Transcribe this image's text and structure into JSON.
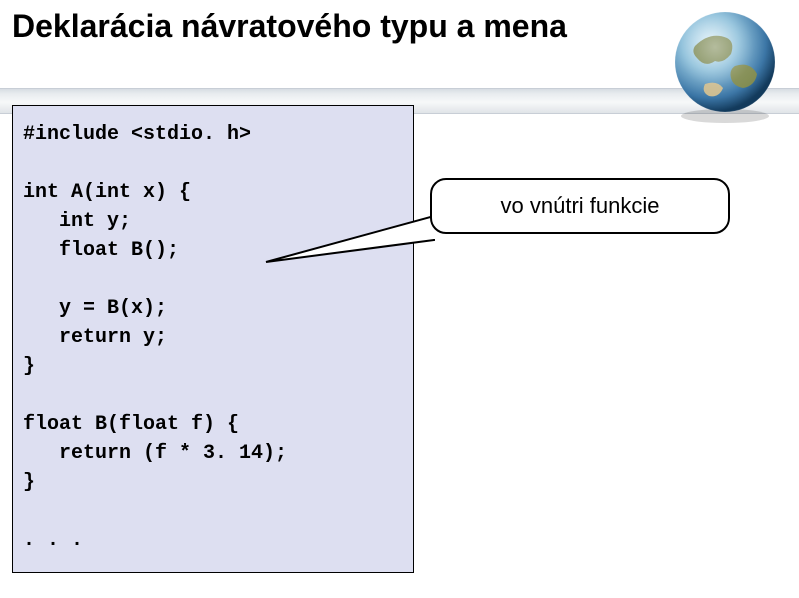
{
  "title": "Deklarácia návratového typu a mena",
  "code": "#include <stdio. h>\n\nint A(int x) {\n   int y;\n   float B();\n\n   y = B(x);\n   return y;\n}\n\nfloat B(float f) {\n   return (f * 3. 14);\n}\n\n. . .",
  "callout": "vo vnútri funkcie"
}
